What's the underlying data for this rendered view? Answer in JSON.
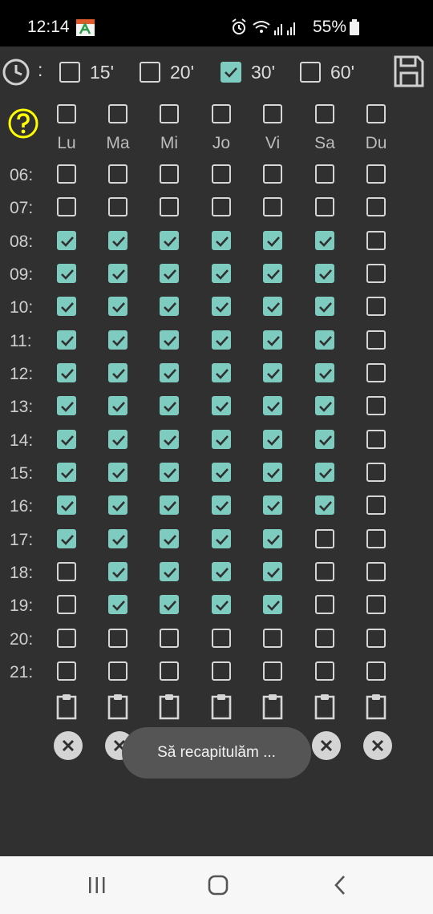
{
  "status_bar": {
    "time": "12:14",
    "battery": "55%"
  },
  "interval": {
    "separator": ":",
    "options": [
      {
        "label": "15'",
        "checked": false
      },
      {
        "label": "20'",
        "checked": false
      },
      {
        "label": "30'",
        "checked": true
      },
      {
        "label": "60'",
        "checked": false
      }
    ]
  },
  "days": [
    "Lu",
    "Ma",
    "Mi",
    "Jo",
    "Vi",
    "Sa",
    "Du"
  ],
  "day_header_checked": [
    false,
    false,
    false,
    false,
    false,
    false,
    false
  ],
  "hours": [
    "06:",
    "07:",
    "08:",
    "09:",
    "10:",
    "11:",
    "12:",
    "13:",
    "14:",
    "15:",
    "16:",
    "17:",
    "18:",
    "19:",
    "20:",
    "21:"
  ],
  "grid": [
    [
      false,
      false,
      false,
      false,
      false,
      false,
      false
    ],
    [
      false,
      false,
      false,
      false,
      false,
      false,
      false
    ],
    [
      true,
      true,
      true,
      true,
      true,
      true,
      false
    ],
    [
      true,
      true,
      true,
      true,
      true,
      true,
      false
    ],
    [
      true,
      true,
      true,
      true,
      true,
      true,
      false
    ],
    [
      true,
      true,
      true,
      true,
      true,
      true,
      false
    ],
    [
      true,
      true,
      true,
      true,
      true,
      true,
      false
    ],
    [
      true,
      true,
      true,
      true,
      true,
      true,
      false
    ],
    [
      true,
      true,
      true,
      true,
      true,
      true,
      false
    ],
    [
      true,
      true,
      true,
      true,
      true,
      true,
      false
    ],
    [
      true,
      true,
      true,
      true,
      true,
      true,
      false
    ],
    [
      true,
      true,
      true,
      true,
      true,
      false,
      false
    ],
    [
      false,
      true,
      true,
      true,
      true,
      false,
      false
    ],
    [
      false,
      true,
      true,
      true,
      true,
      false,
      false
    ],
    [
      false,
      false,
      false,
      false,
      false,
      false,
      false
    ],
    [
      false,
      false,
      false,
      false,
      false,
      false,
      false
    ]
  ],
  "toast": "Să recapitulăm ...",
  "colors": {
    "accent": "#7ecbbf",
    "help": "#ffff00",
    "background": "#303030"
  }
}
